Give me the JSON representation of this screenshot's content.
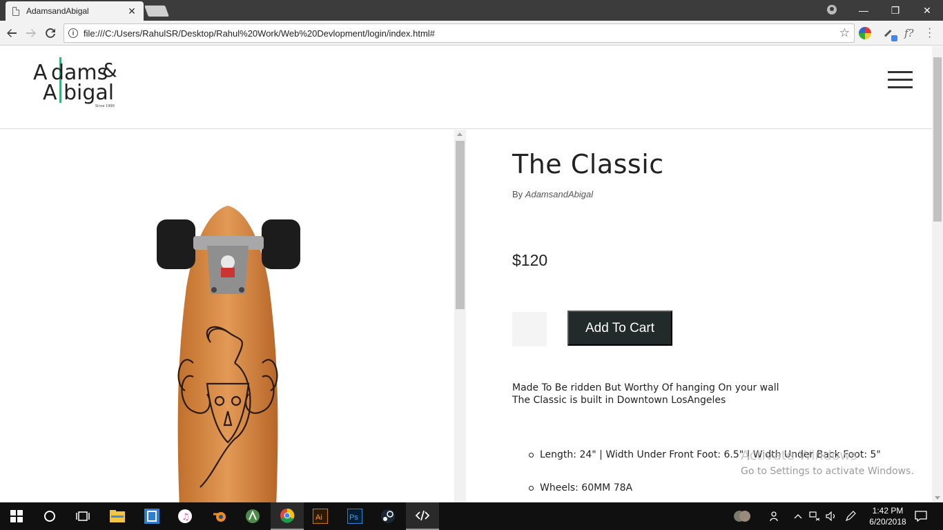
{
  "browser": {
    "tab_title": "AdamsandAbigal",
    "tab_close": "✕",
    "url": "file:///C:/Users/RahulSR/Desktop/Rahul%20Work/Web%20Devlopment/login/index.html#",
    "ext_f": "f?",
    "window_controls": {
      "minimize": "—",
      "restore": "❐",
      "close": "✕"
    }
  },
  "site": {
    "logo_text": "Adams & Abigal",
    "logo_sub": "Since 1990"
  },
  "product": {
    "title": "The Classic",
    "by_prefix": "By",
    "brand": "AdamsandAbigal",
    "price": "$120",
    "add_to_cart": "Add To Cart",
    "desc_line1": "Made To Be ridden But Worthy Of hanging On your wall",
    "desc_line2": "The Classic is built in Downtown LosAngeles",
    "specs": [
      "Length: 24\" | Width Under Front Foot: 6.5\" | Width Under Back Foot: 5\"",
      "Wheels: 60MM 78A"
    ]
  },
  "watermark": {
    "line1": "Activate Windows",
    "line2": "Go to Settings to activate Windows."
  },
  "taskbar": {
    "time": "1:42 PM",
    "date": "6/20/2018"
  }
}
